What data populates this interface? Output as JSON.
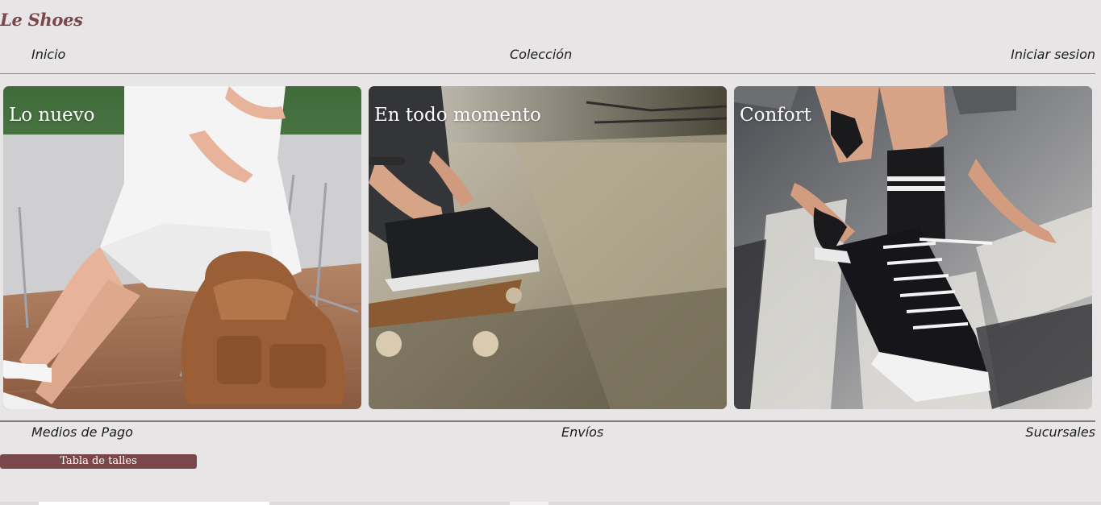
{
  "brand": {
    "name": "Le Shoes"
  },
  "nav": {
    "home": "Inicio",
    "collection": "Colección",
    "login": "Iniciar sesion"
  },
  "cards": [
    {
      "label": "Lo nuevo"
    },
    {
      "label": "En todo momento"
    },
    {
      "label": "Confort"
    }
  ],
  "footer": {
    "payment": "Medios de Pago",
    "shipping": "Envíos",
    "branches": "Sucursales"
  },
  "size_chart_button": "Tabla de talles",
  "colors": {
    "brand": "#7a474b",
    "background": "#e8e5e6"
  }
}
